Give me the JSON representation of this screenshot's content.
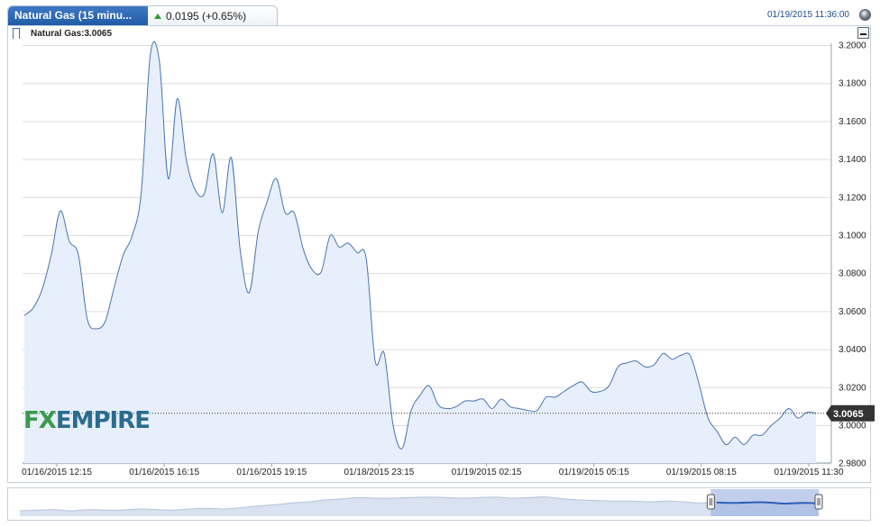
{
  "header": {
    "tab_title": "Natural Gas (15 minu...",
    "change_text": "0.0195 (+0.65%)",
    "timestamp": "01/19/2015 11:36:00"
  },
  "legend": {
    "label": "Natural Gas:3.0065"
  },
  "logo": {
    "fx": "FX",
    "rest": "EMPIRE"
  },
  "colors": {
    "line": "#4a73b0",
    "fill": "#e6effb",
    "nav_selected": "#2f5fb8",
    "accent_up": "#2e9e2e"
  },
  "chart_data": {
    "type": "area",
    "title": "",
    "xlabel": "",
    "ylabel": "",
    "ylim": [
      2.98,
      3.205
    ],
    "y_ticks": [
      "3.2000",
      "3.1800",
      "3.1600",
      "3.1400",
      "3.1200",
      "3.1000",
      "3.0800",
      "3.0600",
      "3.0400",
      "3.0200",
      "3.0000",
      "2.9800"
    ],
    "x_tick_labels": [
      "01/16/2015 12:15",
      "01/16/2015 16:15",
      "01/16/2015 19:15",
      "01/18/2015 23:15",
      "01/19/2015 02:15",
      "01/19/2015 05:15",
      "01/19/2015 08:15",
      "01/19/2015 11:30"
    ],
    "last_value": 3.0065,
    "last_value_label": "3.0065",
    "grid": true,
    "series": [
      {
        "name": "Natural Gas",
        "values": [
          3.058,
          3.062,
          3.072,
          3.09,
          3.113,
          3.097,
          3.09,
          3.056,
          3.051,
          3.055,
          3.073,
          3.09,
          3.1,
          3.123,
          3.195,
          3.192,
          3.13,
          3.172,
          3.14,
          3.124,
          3.122,
          3.143,
          3.112,
          3.141,
          3.092,
          3.07,
          3.102,
          3.118,
          3.13,
          3.112,
          3.112,
          3.093,
          3.082,
          3.081,
          3.1,
          3.094,
          3.096,
          3.091,
          3.088,
          3.034,
          3.038,
          3.0,
          2.988,
          3.008,
          3.016,
          3.021,
          3.011,
          3.009,
          3.01,
          3.013,
          3.013,
          3.014,
          3.009,
          3.014,
          3.01,
          3.009,
          3.008,
          3.008,
          3.015,
          3.015,
          3.018,
          3.021,
          3.023,
          3.018,
          3.018,
          3.021,
          3.031,
          3.033,
          3.034,
          3.031,
          3.032,
          3.038,
          3.035,
          3.037,
          3.037,
          3.022,
          3.004,
          2.997,
          2.99,
          2.994,
          2.99,
          2.995,
          2.995,
          3.0,
          3.004,
          3.009,
          3.004,
          3.007,
          3.0065
        ]
      }
    ],
    "navigator": {
      "values": [
        2.994,
        2.995,
        2.996,
        2.994,
        2.996,
        2.995,
        2.995,
        2.997,
        2.996,
        2.995,
        2.997,
        2.998,
        2.997,
        2.999,
        3.002,
        3.004,
        3.007,
        3.009,
        3.012,
        3.014,
        3.016,
        3.015,
        3.015,
        3.016,
        3.017,
        3.016,
        3.015,
        3.016,
        3.017,
        3.015,
        3.016,
        3.017,
        3.014,
        3.012,
        3.011,
        3.01,
        3.01,
        3.009,
        3.01,
        3.009,
        3.007,
        3.008,
        3.007,
        3.008,
        3.008,
        3.006,
        3.007,
        3.0065
      ],
      "selected_range": [
        0.865,
        1.0
      ]
    }
  }
}
